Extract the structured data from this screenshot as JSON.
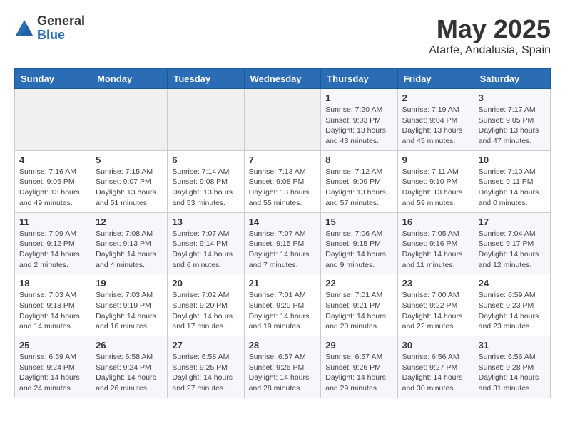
{
  "logo": {
    "general": "General",
    "blue": "Blue"
  },
  "title": {
    "month_year": "May 2025",
    "location": "Atarfe, Andalusia, Spain"
  },
  "headers": [
    "Sunday",
    "Monday",
    "Tuesday",
    "Wednesday",
    "Thursday",
    "Friday",
    "Saturday"
  ],
  "weeks": [
    [
      {
        "day": "",
        "info": ""
      },
      {
        "day": "",
        "info": ""
      },
      {
        "day": "",
        "info": ""
      },
      {
        "day": "",
        "info": ""
      },
      {
        "day": "1",
        "info": "Sunrise: 7:20 AM\nSunset: 9:03 PM\nDaylight: 13 hours\nand 43 minutes."
      },
      {
        "day": "2",
        "info": "Sunrise: 7:19 AM\nSunset: 9:04 PM\nDaylight: 13 hours\nand 45 minutes."
      },
      {
        "day": "3",
        "info": "Sunrise: 7:17 AM\nSunset: 9:05 PM\nDaylight: 13 hours\nand 47 minutes."
      }
    ],
    [
      {
        "day": "4",
        "info": "Sunrise: 7:16 AM\nSunset: 9:06 PM\nDaylight: 13 hours\nand 49 minutes."
      },
      {
        "day": "5",
        "info": "Sunrise: 7:15 AM\nSunset: 9:07 PM\nDaylight: 13 hours\nand 51 minutes."
      },
      {
        "day": "6",
        "info": "Sunrise: 7:14 AM\nSunset: 9:08 PM\nDaylight: 13 hours\nand 53 minutes."
      },
      {
        "day": "7",
        "info": "Sunrise: 7:13 AM\nSunset: 9:08 PM\nDaylight: 13 hours\nand 55 minutes."
      },
      {
        "day": "8",
        "info": "Sunrise: 7:12 AM\nSunset: 9:09 PM\nDaylight: 13 hours\nand 57 minutes."
      },
      {
        "day": "9",
        "info": "Sunrise: 7:11 AM\nSunset: 9:10 PM\nDaylight: 13 hours\nand 59 minutes."
      },
      {
        "day": "10",
        "info": "Sunrise: 7:10 AM\nSunset: 9:11 PM\nDaylight: 14 hours\nand 0 minutes."
      }
    ],
    [
      {
        "day": "11",
        "info": "Sunrise: 7:09 AM\nSunset: 9:12 PM\nDaylight: 14 hours\nand 2 minutes."
      },
      {
        "day": "12",
        "info": "Sunrise: 7:08 AM\nSunset: 9:13 PM\nDaylight: 14 hours\nand 4 minutes."
      },
      {
        "day": "13",
        "info": "Sunrise: 7:07 AM\nSunset: 9:14 PM\nDaylight: 14 hours\nand 6 minutes."
      },
      {
        "day": "14",
        "info": "Sunrise: 7:07 AM\nSunset: 9:15 PM\nDaylight: 14 hours\nand 7 minutes."
      },
      {
        "day": "15",
        "info": "Sunrise: 7:06 AM\nSunset: 9:15 PM\nDaylight: 14 hours\nand 9 minutes."
      },
      {
        "day": "16",
        "info": "Sunrise: 7:05 AM\nSunset: 9:16 PM\nDaylight: 14 hours\nand 11 minutes."
      },
      {
        "day": "17",
        "info": "Sunrise: 7:04 AM\nSunset: 9:17 PM\nDaylight: 14 hours\nand 12 minutes."
      }
    ],
    [
      {
        "day": "18",
        "info": "Sunrise: 7:03 AM\nSunset: 9:18 PM\nDaylight: 14 hours\nand 14 minutes."
      },
      {
        "day": "19",
        "info": "Sunrise: 7:03 AM\nSunset: 9:19 PM\nDaylight: 14 hours\nand 16 minutes."
      },
      {
        "day": "20",
        "info": "Sunrise: 7:02 AM\nSunset: 9:20 PM\nDaylight: 14 hours\nand 17 minutes."
      },
      {
        "day": "21",
        "info": "Sunrise: 7:01 AM\nSunset: 9:20 PM\nDaylight: 14 hours\nand 19 minutes."
      },
      {
        "day": "22",
        "info": "Sunrise: 7:01 AM\nSunset: 9:21 PM\nDaylight: 14 hours\nand 20 minutes."
      },
      {
        "day": "23",
        "info": "Sunrise: 7:00 AM\nSunset: 9:22 PM\nDaylight: 14 hours\nand 22 minutes."
      },
      {
        "day": "24",
        "info": "Sunrise: 6:59 AM\nSunset: 9:23 PM\nDaylight: 14 hours\nand 23 minutes."
      }
    ],
    [
      {
        "day": "25",
        "info": "Sunrise: 6:59 AM\nSunset: 9:24 PM\nDaylight: 14 hours\nand 24 minutes."
      },
      {
        "day": "26",
        "info": "Sunrise: 6:58 AM\nSunset: 9:24 PM\nDaylight: 14 hours\nand 26 minutes."
      },
      {
        "day": "27",
        "info": "Sunrise: 6:58 AM\nSunset: 9:25 PM\nDaylight: 14 hours\nand 27 minutes."
      },
      {
        "day": "28",
        "info": "Sunrise: 6:57 AM\nSunset: 9:26 PM\nDaylight: 14 hours\nand 28 minutes."
      },
      {
        "day": "29",
        "info": "Sunrise: 6:57 AM\nSunset: 9:26 PM\nDaylight: 14 hours\nand 29 minutes."
      },
      {
        "day": "30",
        "info": "Sunrise: 6:56 AM\nSunset: 9:27 PM\nDaylight: 14 hours\nand 30 minutes."
      },
      {
        "day": "31",
        "info": "Sunrise: 6:56 AM\nSunset: 9:28 PM\nDaylight: 14 hours\nand 31 minutes."
      }
    ]
  ]
}
